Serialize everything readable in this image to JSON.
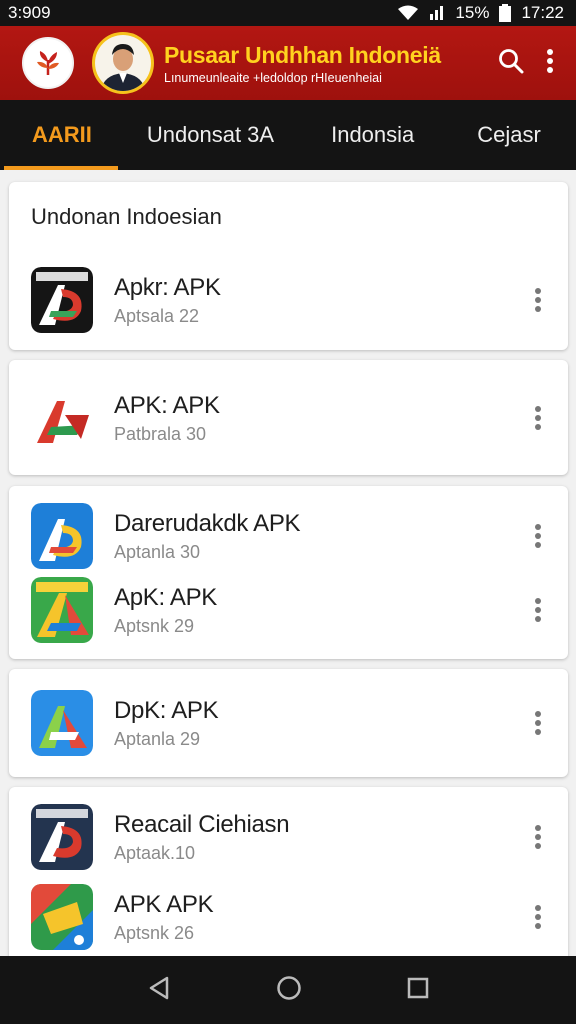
{
  "status_bar": {
    "time_left": "3:909",
    "battery": "15%",
    "time_right": "17:22"
  },
  "app_bar": {
    "title": "Pusaar Undhhan Indoneiä",
    "subtitle": "Lınumeunleaite +ledoldop rHIeuenheiai"
  },
  "tabs": [
    {
      "label": "AARII",
      "active": true
    },
    {
      "label": "Undonsat 3A",
      "active": false
    },
    {
      "label": "Indonsia",
      "active": false
    },
    {
      "label": "Cejasr",
      "active": false
    }
  ],
  "cards": [
    {
      "header": "Undonan Indoesian",
      "items": [
        {
          "title": "Apkr: APK",
          "subtitle": "Aptsala 22",
          "icon": "app-logo-dark"
        }
      ]
    },
    {
      "header": "",
      "items": [
        {
          "title": "APK: APK",
          "subtitle": "Patbrala 30",
          "icon": "app-logo-white-ppk"
        }
      ]
    },
    {
      "header": "",
      "items": [
        {
          "title": "Darerudakdk APK",
          "subtitle": "Aptanla 30",
          "icon": "app-logo-blue"
        },
        {
          "title": "ApK: APK",
          "subtitle": "Aptsnk 29",
          "icon": "app-logo-green"
        }
      ]
    },
    {
      "header": "",
      "items": [
        {
          "title": "DpK: APK",
          "subtitle": "Aptanla 29",
          "icon": "app-logo-blue-light"
        }
      ]
    },
    {
      "header": "",
      "items": [
        {
          "title": "Reacail Ciehiasn",
          "subtitle": "Aptaak.10",
          "icon": "app-logo-navy"
        },
        {
          "title": "APK APK",
          "subtitle": "Aptsnk 26",
          "icon": "app-logo-multicolor"
        }
      ]
    }
  ],
  "icons": {
    "appbar_logo": "leaf-logo-icon",
    "avatar": "person-avatar",
    "search": "search-icon",
    "menu": "more-vert-icon",
    "nav_back": "back-triangle-icon",
    "nav_home": "home-circle-icon",
    "nav_recent": "recent-square-icon"
  },
  "colors": {
    "appbar": "#b31712",
    "title": "#ffd21f",
    "tab_active": "#f39a1d",
    "dark_bar": "#141414"
  }
}
